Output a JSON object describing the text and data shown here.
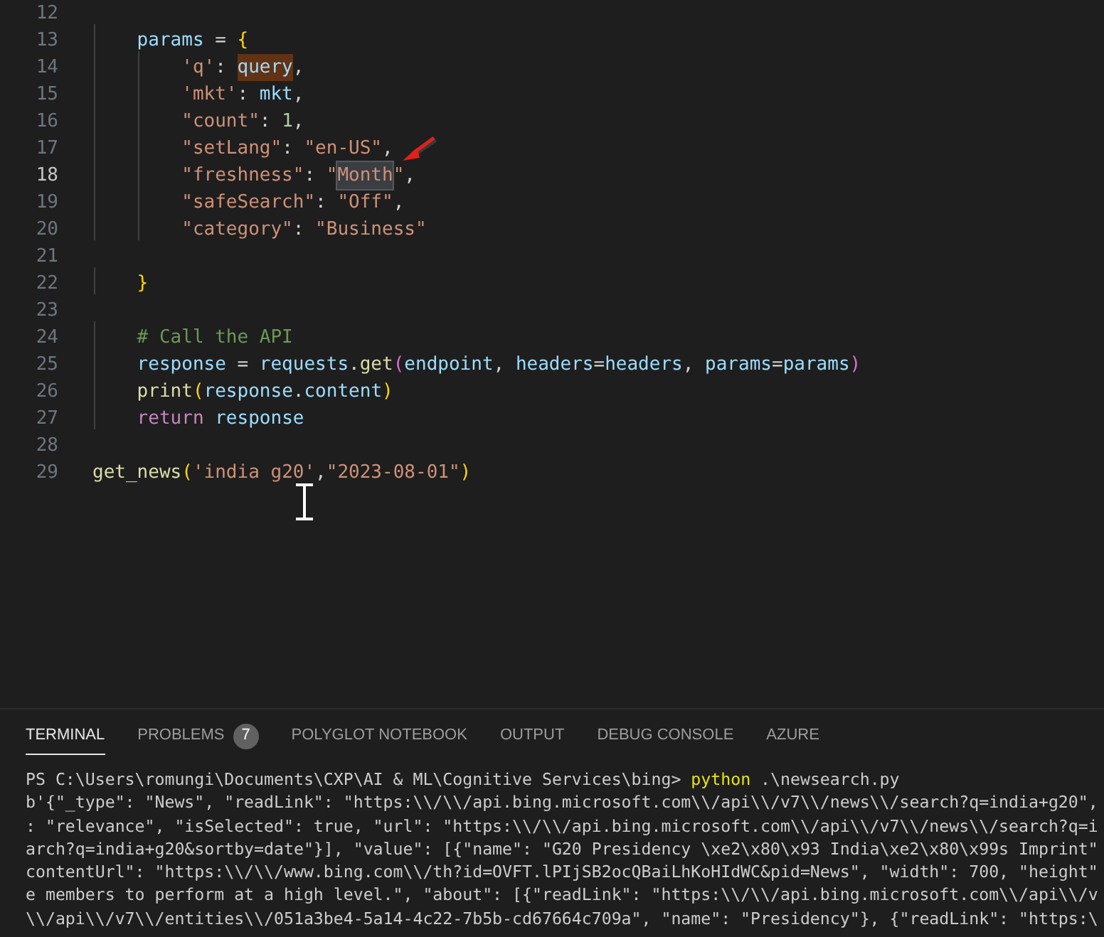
{
  "editor": {
    "lines": [
      {
        "number": "12",
        "current": false
      },
      {
        "number": "13",
        "current": false,
        "tokens": [
          {
            "text": "    params",
            "kind": "var"
          },
          {
            "text": " = ",
            "kind": "op"
          },
          {
            "text": "{",
            "kind": "brace"
          }
        ]
      },
      {
        "number": "14",
        "current": false,
        "tokens": [
          {
            "text": "        'q'",
            "kind": "string"
          },
          {
            "text": ": ",
            "kind": "op"
          },
          {
            "text": "query",
            "kind": "var",
            "highlighted": true
          },
          {
            "text": ",",
            "kind": "op"
          }
        ]
      },
      {
        "number": "15",
        "current": false,
        "tokens": [
          {
            "text": "        'mkt'",
            "kind": "string"
          },
          {
            "text": ": ",
            "kind": "op"
          },
          {
            "text": "mkt",
            "kind": "var"
          },
          {
            "text": ",",
            "kind": "op"
          }
        ]
      },
      {
        "number": "16",
        "current": false,
        "tokens": [
          {
            "text": "        \"count\"",
            "kind": "string"
          },
          {
            "text": ": ",
            "kind": "op"
          },
          {
            "text": "1",
            "kind": "number"
          },
          {
            "text": ",",
            "kind": "op"
          }
        ]
      },
      {
        "number": "17",
        "current": false,
        "tokens": [
          {
            "text": "        \"setLang\"",
            "kind": "string"
          },
          {
            "text": ": ",
            "kind": "op"
          },
          {
            "text": "\"en-US\"",
            "kind": "string"
          },
          {
            "text": ",",
            "kind": "op"
          }
        ]
      },
      {
        "number": "18",
        "current": true,
        "tokens": [
          {
            "text": "        \"freshness\"",
            "kind": "string"
          },
          {
            "text": ": ",
            "kind": "op"
          },
          {
            "text": "\"",
            "kind": "string"
          },
          {
            "text": "Month",
            "kind": "string",
            "selected": true
          },
          {
            "text": "\"",
            "kind": "string"
          },
          {
            "text": ",",
            "kind": "op"
          }
        ]
      },
      {
        "number": "19",
        "current": false,
        "tokens": [
          {
            "text": "        \"safeSearch\"",
            "kind": "string"
          },
          {
            "text": ": ",
            "kind": "op"
          },
          {
            "text": "\"Off\"",
            "kind": "string"
          },
          {
            "text": ",",
            "kind": "op"
          }
        ]
      },
      {
        "number": "20",
        "current": false,
        "tokens": [
          {
            "text": "        \"category\"",
            "kind": "string"
          },
          {
            "text": ": ",
            "kind": "op"
          },
          {
            "text": "\"Business\"",
            "kind": "string"
          }
        ]
      },
      {
        "number": "21",
        "current": false
      },
      {
        "number": "22",
        "current": false,
        "tokens": [
          {
            "text": "    }",
            "kind": "brace"
          }
        ]
      },
      {
        "number": "23",
        "current": false
      },
      {
        "number": "24",
        "current": false,
        "tokens": [
          {
            "text": "    # Call the API",
            "kind": "comment"
          }
        ]
      },
      {
        "number": "25",
        "current": false,
        "tokens": [
          {
            "text": "    response",
            "kind": "var"
          },
          {
            "text": " = ",
            "kind": "op"
          },
          {
            "text": "requests",
            "kind": "var"
          },
          {
            "text": ".",
            "kind": "op"
          },
          {
            "text": "get",
            "kind": "func"
          },
          {
            "text": "(",
            "kind": "paren"
          },
          {
            "text": "endpoint",
            "kind": "var"
          },
          {
            "text": ", ",
            "kind": "op"
          },
          {
            "text": "headers",
            "kind": "var"
          },
          {
            "text": "=",
            "kind": "op"
          },
          {
            "text": "headers",
            "kind": "var"
          },
          {
            "text": ", ",
            "kind": "op"
          },
          {
            "text": "params",
            "kind": "var"
          },
          {
            "text": "=",
            "kind": "op"
          },
          {
            "text": "params",
            "kind": "var"
          },
          {
            "text": ")",
            "kind": "paren"
          }
        ]
      },
      {
        "number": "26",
        "current": false,
        "tokens": [
          {
            "text": "    print",
            "kind": "func"
          },
          {
            "text": "(",
            "kind": "brace"
          },
          {
            "text": "response",
            "kind": "var"
          },
          {
            "text": ".",
            "kind": "op"
          },
          {
            "text": "content",
            "kind": "var"
          },
          {
            "text": ")",
            "kind": "brace"
          }
        ]
      },
      {
        "number": "27",
        "current": false,
        "tokens": [
          {
            "text": "    return",
            "kind": "keyword"
          },
          {
            "text": " response",
            "kind": "var"
          }
        ]
      },
      {
        "number": "28",
        "current": false
      },
      {
        "number": "29",
        "current": false,
        "tokens": [
          {
            "text": "get_news",
            "kind": "func"
          },
          {
            "text": "(",
            "kind": "brace"
          },
          {
            "text": "'india g20'",
            "kind": "string"
          },
          {
            "text": ",",
            "kind": "op"
          },
          {
            "text": "\"2023-08-01\"",
            "kind": "string"
          },
          {
            "text": ")",
            "kind": "brace"
          }
        ]
      }
    ]
  },
  "panel": {
    "tabs": [
      {
        "label": "TERMINAL",
        "selected": true
      },
      {
        "label": "PROBLEMS",
        "selected": false,
        "badge": "7"
      },
      {
        "label": "POLYGLOT NOTEBOOK",
        "selected": false
      },
      {
        "label": "OUTPUT",
        "selected": false
      },
      {
        "label": "DEBUG CONSOLE",
        "selected": false
      },
      {
        "label": "AZURE",
        "selected": false
      }
    ],
    "terminal": {
      "prompt": "PS C:\\Users\\romungi\\Documents\\CXP\\AI & ML\\Cognitive Services\\bing> ",
      "command": "python",
      "args": " .\\newsearch.py",
      "output": [
        "b'{\"_type\": \"News\", \"readLink\": \"https:\\\\/\\\\/api.bing.microsoft.com\\\\/api\\\\/v7\\\\/news\\\\/search?q=india+g20\",",
        ": \"relevance\", \"isSelected\": true, \"url\": \"https:\\\\/\\\\/api.bing.microsoft.com\\\\/api\\\\/v7\\\\/news\\\\/search?q=i",
        "arch?q=india+g20&sortby=date\"}], \"value\": [{\"name\": \"G20 Presidency \\xe2\\x80\\x93 India\\xe2\\x80\\x99s Imprint\"",
        "contentUrl\": \"https:\\\\/\\\\/www.bing.com\\\\/th?id=OVFT.lPIjSB2ocQBaiLhKoHIdWC&pid=News\", \"width\": 700, \"height\"",
        "e members to perform at a high level.\", \"about\": [{\"readLink\": \"https:\\\\/\\\\/api.bing.microsoft.com\\\\/api\\\\/v",
        "\\\\/api\\\\/v7\\\\/entities\\\\/051a3be4-5a14-4c22-7b5b-cd67664c709a\", \"name\": \"Presidency\"}, {\"readLink\": \"https:\\"
      ]
    }
  }
}
